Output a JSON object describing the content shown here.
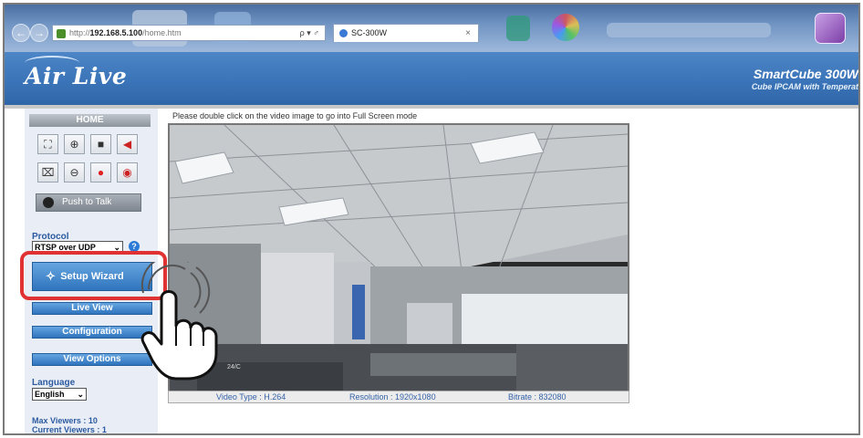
{
  "browser": {
    "url_prefix": "http://",
    "url_domain": "192.168.5.100",
    "url_path": "/home.htm",
    "url_controls": "ρ ▾ ♂",
    "tab_title": "SC-300W",
    "tab_close": "×",
    "back_glyph": "←",
    "forward_glyph": "→"
  },
  "header": {
    "logo": "Air Live",
    "product_name": "SmartCube 300W",
    "product_subtitle": "Cube IPCAM with Temperat"
  },
  "sidebar": {
    "home_label": "HOME",
    "controls": [
      {
        "name": "fullscreen-button",
        "icon": "fullscreen-icon",
        "glyph": "⛶",
        "color": "#333333"
      },
      {
        "name": "zoom-in-button",
        "icon": "zoom-in-icon",
        "glyph": "⊕",
        "color": "#333333"
      },
      {
        "name": "snapshot-button",
        "icon": "camera-icon",
        "glyph": "■",
        "color": "#222222"
      },
      {
        "name": "audio-button",
        "icon": "speaker-icon",
        "glyph": "◀",
        "color": "#cc2222"
      },
      {
        "name": "fit-screen-button",
        "icon": "fit-screen-icon",
        "glyph": "⌧",
        "color": "#333333"
      },
      {
        "name": "zoom-out-button",
        "icon": "zoom-out-icon",
        "glyph": "⊖",
        "color": "#333333"
      },
      {
        "name": "record-button",
        "icon": "record-icon",
        "glyph": "●",
        "color": "#e02020"
      },
      {
        "name": "mic-button",
        "icon": "microphone-icon",
        "glyph": "◉",
        "color": "#cc2222"
      }
    ],
    "push_to_talk": "Push to Talk",
    "protocol_label": "Protocol",
    "protocol_value": "RTSP over UDP",
    "help": "?",
    "setup_wizard": "Setup Wizard",
    "live_view": "Live View",
    "configuration": "Configuration",
    "view_options": "View Options",
    "language_label": "Language",
    "language_value": "English",
    "max_viewers": "Max Viewers :  10",
    "current_viewers": "Current Viewers :  1"
  },
  "main": {
    "instruction": "Please double click on the video image to go into Full Screen mode",
    "overlay_timestamp": "24/C",
    "video_type": "Video Type :  H.264",
    "resolution": "Resolution :  1920x1080",
    "bitrate": "Bitrate :  832080"
  },
  "colors": {
    "header_blue": "#3b74b8",
    "button_blue": "#2f74bd",
    "label_blue": "#2c5aa0",
    "highlight_red": "#e03232"
  }
}
